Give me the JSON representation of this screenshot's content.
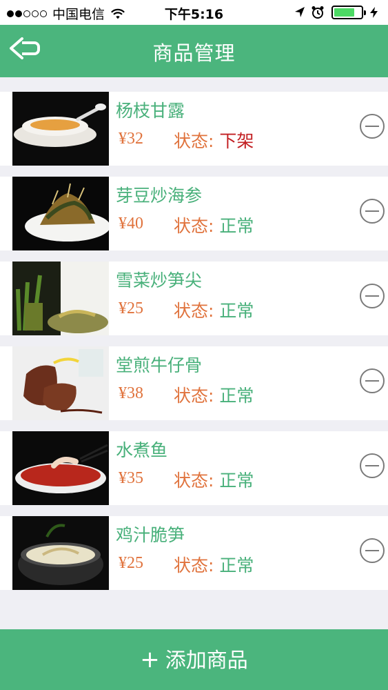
{
  "status_bar": {
    "carrier": "中国电信",
    "time": "下午5:16",
    "battery_level": 0.75
  },
  "nav": {
    "title": "商品管理"
  },
  "currency_symbol": "¥",
  "status_prefix": "状态:",
  "products": [
    {
      "name": "杨枝甘露",
      "price": "32",
      "status": "下架",
      "status_color": "#c21f22",
      "image": "dessert-soup-photo"
    },
    {
      "name": "芽豆炒海参",
      "price": "40",
      "status": "正常",
      "status_color": "#48b07a",
      "image": "stir-fry-sea-cucumber-photo"
    },
    {
      "name": "雪菜炒笋尖",
      "price": "25",
      "status": "正常",
      "status_color": "#48b07a",
      "image": "bamboo-shoot-dish-photo"
    },
    {
      "name": "堂煎牛仔骨",
      "price": "38",
      "status": "正常",
      "status_color": "#48b07a",
      "image": "beef-ribs-photo"
    },
    {
      "name": "水煮鱼",
      "price": "35",
      "status": "正常",
      "status_color": "#48b07a",
      "image": "boiled-fish-photo"
    },
    {
      "name": "鸡汁脆笋",
      "price": "25",
      "status": "正常",
      "status_color": "#48b07a",
      "image": "bamboo-in-broth-photo"
    }
  ],
  "footer": {
    "plus": "+",
    "add_label": "添加商品"
  },
  "colors": {
    "brand_green": "#4bb57d",
    "price_orange": "#e0733d",
    "off_red": "#c21f22"
  }
}
